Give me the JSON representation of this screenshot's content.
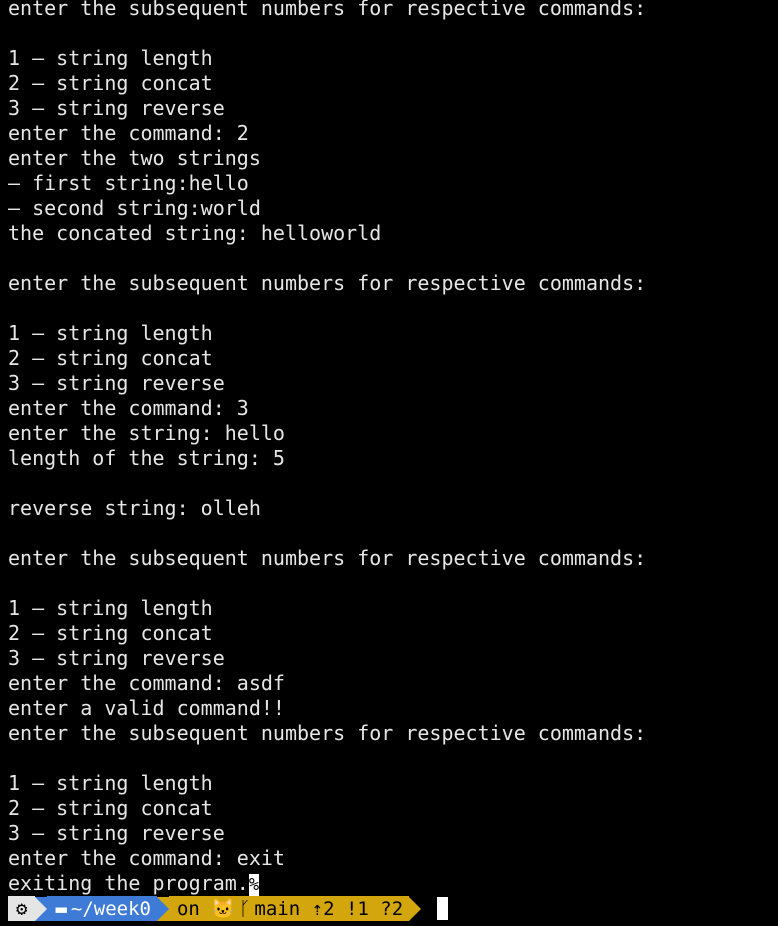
{
  "terminal": {
    "lines": [
      "enter the subsequent numbers for respective commands:",
      "",
      "1 – string length",
      "2 – string concat",
      "3 – string reverse",
      "enter the command: 2",
      "enter the two strings",
      "– first string:hello",
      "– second string:world",
      "the concated string: helloworld",
      "",
      "enter the subsequent numbers for respective commands:",
      "",
      "1 – string length",
      "2 – string concat",
      "3 – string reverse",
      "enter the command: 3",
      "enter the string: hello",
      "length of the string: 5",
      "",
      "reverse string: olleh",
      "",
      "enter the subsequent numbers for respective commands:",
      "",
      "1 – string length",
      "2 – string concat",
      "3 – string reverse",
      "enter the command: asdf",
      "enter a valid command!!",
      "enter the subsequent numbers for respective commands:",
      "",
      "1 – string length",
      "2 – string concat",
      "3 – string reverse",
      "enter the command: exit"
    ],
    "last_line": "exiting the program.",
    "eol_marker": "%"
  },
  "prompt": {
    "os_icon": "gear-like-os-icon",
    "os_glyph": "⚙",
    "folder_icon": "folder-icon",
    "folder_glyph": "▬",
    "path": "~/week0",
    "on_label": "on",
    "github_icon": "github-icon",
    "github_glyph": "🐱",
    "branch_icon": "git-branch-icon",
    "branch_glyph": "ᚴ",
    "branch": "main",
    "status": "⇡2 !1 ?2",
    "colors": {
      "os_segment": "#e5e5e5",
      "dir_segment": "#3e7bd6",
      "git_segment": "#d3a60e",
      "background": "#000000",
      "text": "#e6e6e6"
    }
  }
}
